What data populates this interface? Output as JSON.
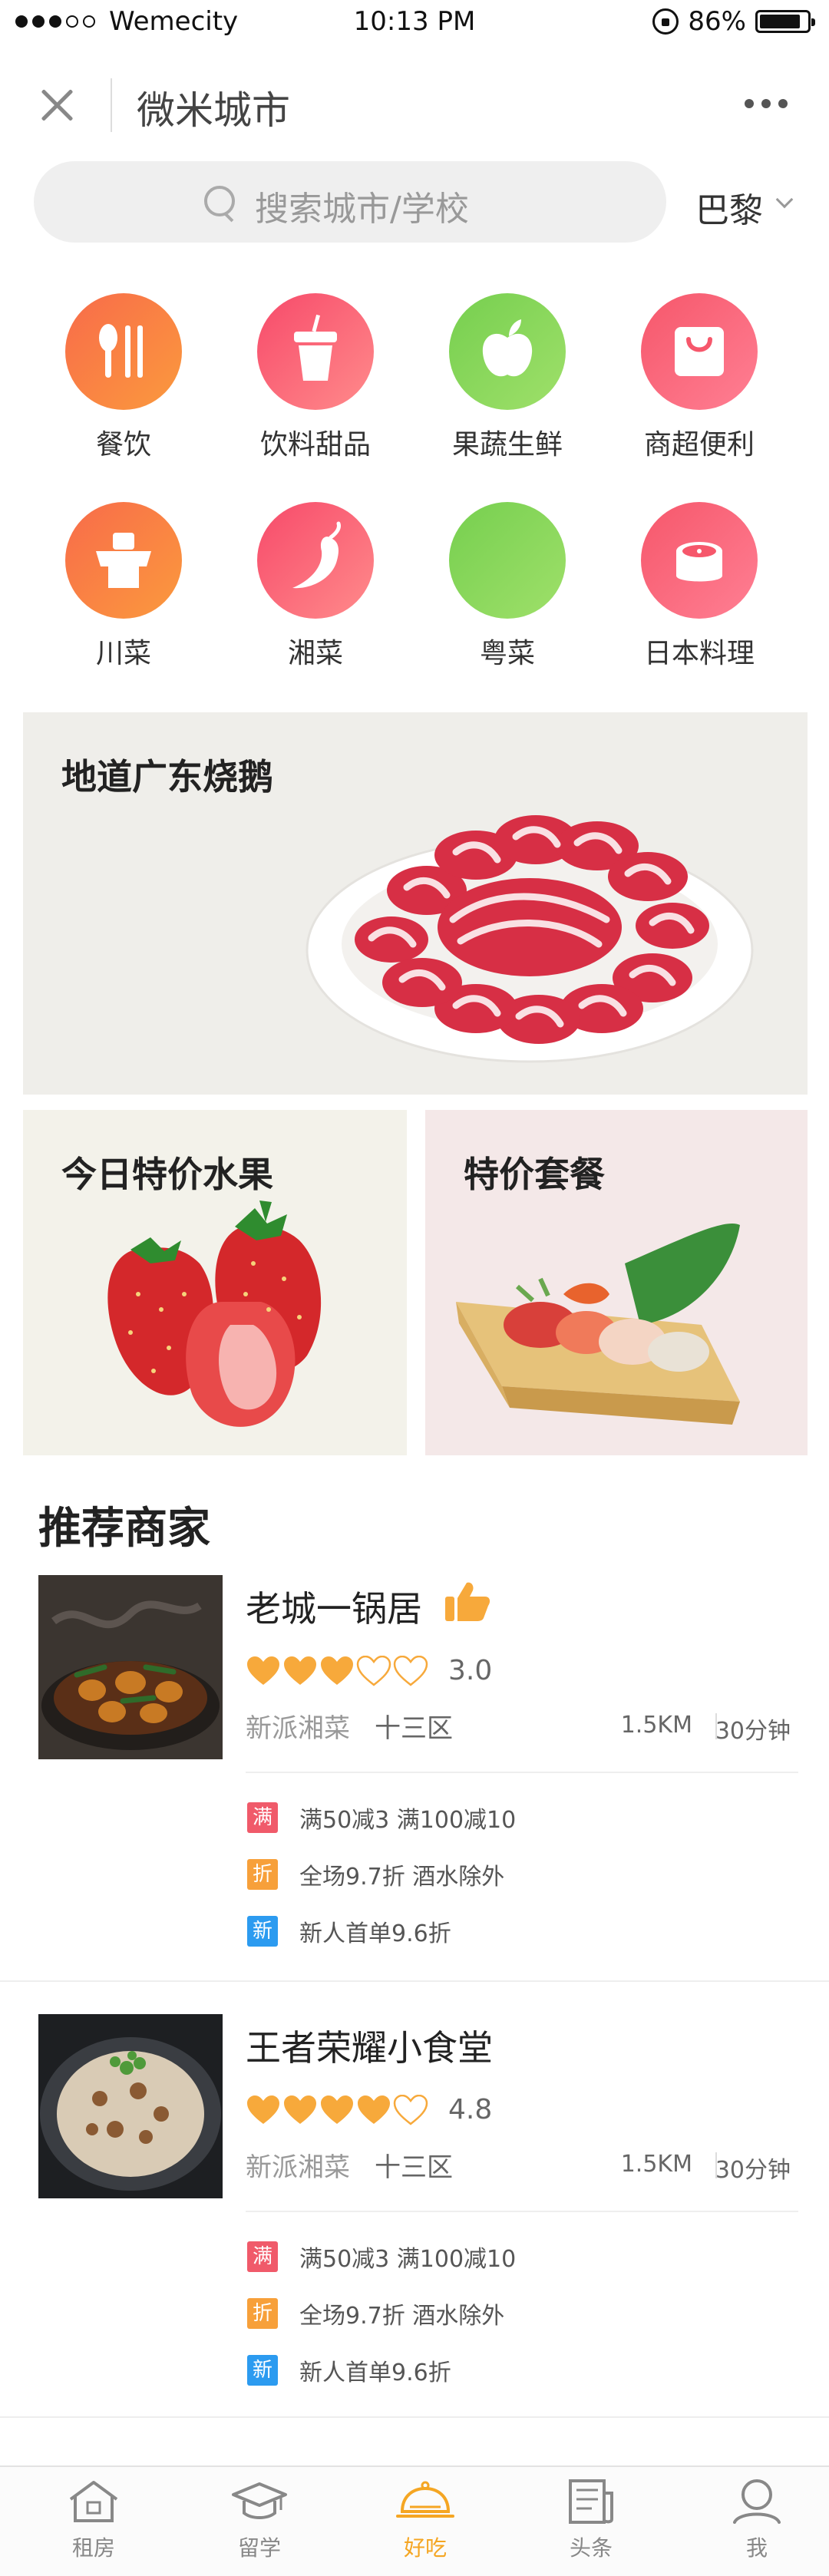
{
  "status_bar": {
    "carrier": "Wemecity",
    "time": "10:13 PM",
    "battery": "86%",
    "battery_level": 0.86
  },
  "nav": {
    "title": "微米城市"
  },
  "search": {
    "placeholder": "搜索城市/学校",
    "city": "巴黎"
  },
  "categories": [
    {
      "label": "餐饮",
      "icon": "cutlery-icon"
    },
    {
      "label": "饮料甜品",
      "icon": "drink-cup-icon"
    },
    {
      "label": "果蔬生鲜",
      "icon": "apple-icon"
    },
    {
      "label": "商超便利",
      "icon": "shopping-bag-icon"
    },
    {
      "label": "川菜",
      "icon": "sichuan-dish-icon"
    },
    {
      "label": "湘菜",
      "icon": "chili-pepper-icon"
    },
    {
      "label": "粤菜",
      "icon": "cantonese-dish-icon"
    },
    {
      "label": "日本料理",
      "icon": "sushi-roll-icon"
    }
  ],
  "banners": {
    "main": {
      "title": "地道广东烧鹅"
    },
    "left": {
      "title": "今日特价水果"
    },
    "right": {
      "title": "特价套餐"
    }
  },
  "section": {
    "title": "推荐商家"
  },
  "merchants": [
    {
      "name": "老城一锅居",
      "score": "3.0",
      "rating": 3,
      "cuisine": "新派湘菜",
      "area": "十三区",
      "distance": "1.5KM",
      "time": "30分钟",
      "promos": [
        {
          "badge": "满",
          "text": "满50减3 满100减10"
        },
        {
          "badge": "折",
          "text": "全场9.7折 酒水除外"
        },
        {
          "badge": "新",
          "text": "新人首单9.6折"
        }
      ]
    },
    {
      "name": "王者荣耀小食堂",
      "score": "4.8",
      "rating": 4,
      "cuisine": "新派湘菜",
      "area": "十三区",
      "distance": "1.5KM",
      "time": "30分钟",
      "promos": [
        {
          "badge": "满",
          "text": "满50减3 满100减10"
        },
        {
          "badge": "折",
          "text": "全场9.7折 酒水除外"
        },
        {
          "badge": "新",
          "text": "新人首单9.6折"
        }
      ]
    }
  ],
  "tabs": [
    {
      "label": "租房",
      "icon": "house-icon"
    },
    {
      "label": "留学",
      "icon": "graduation-cap-icon"
    },
    {
      "label": "好吃",
      "icon": "food-cloche-icon",
      "active": true
    },
    {
      "label": "头条",
      "icon": "news-icon"
    },
    {
      "label": "我",
      "icon": "user-icon"
    }
  ],
  "colors": {
    "accent": "#f5a623",
    "heart": "#f7a93b",
    "promo_red": "#f05a6a",
    "promo_orange": "#f7a03a",
    "promo_blue": "#2c9bf0"
  }
}
